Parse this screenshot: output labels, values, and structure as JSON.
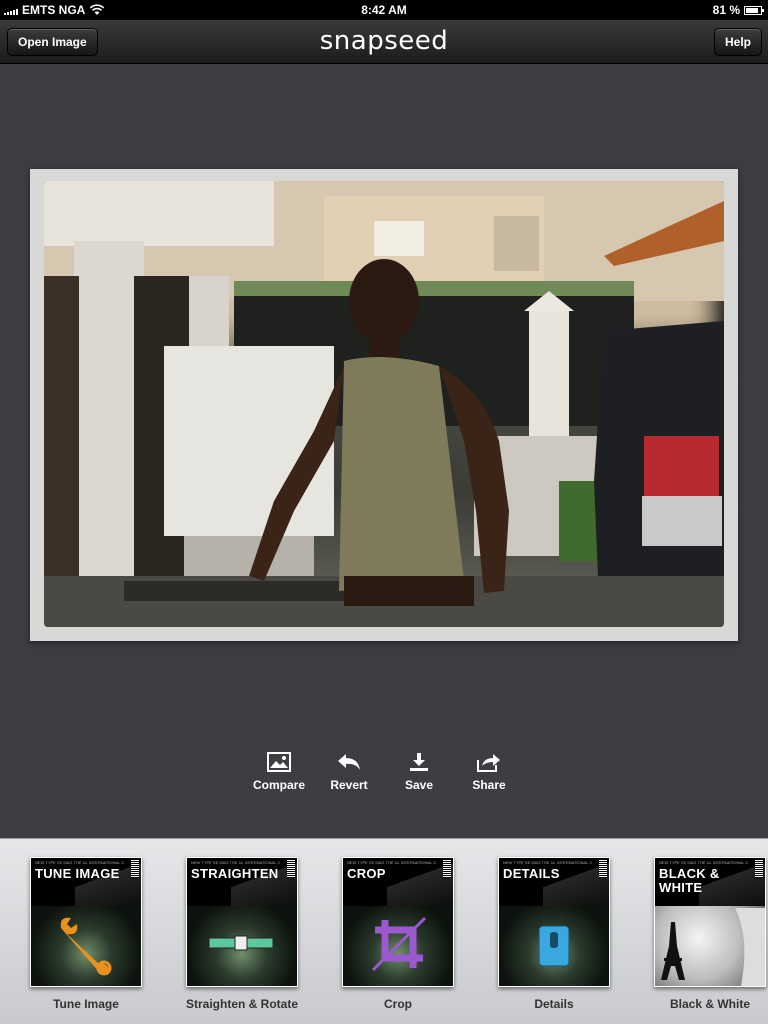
{
  "status": {
    "carrier": "EMTS NGA",
    "time": "8:42 AM",
    "battery": "81 %"
  },
  "navbar": {
    "open_label": "Open Image",
    "logo": "snapseed",
    "help_label": "Help"
  },
  "toolbar": {
    "compare_label": "Compare",
    "revert_label": "Revert",
    "save_label": "Save",
    "share_label": "Share"
  },
  "filters": [
    {
      "card_title": "TUNE IMAGE",
      "label": "Tune Image",
      "icon": "wrench-icon"
    },
    {
      "card_title": "STRAIGHTEN",
      "label": "Straighten & Rotate",
      "icon": "level-icon"
    },
    {
      "card_title": "CROP",
      "label": "Crop",
      "icon": "crop-icon"
    },
    {
      "card_title": "DETAILS",
      "label": "Details",
      "icon": "sharpener-icon"
    },
    {
      "card_title": "BLACK & WHITE",
      "label": "Black & White",
      "icon": "eiffel-tower-photo"
    }
  ],
  "card_fineprint": "NEW TYPE SE MAG THE UL INTERNATIONAL 3",
  "colors": {
    "accent_orange": "#e8911f",
    "level_green": "#5dc8a0",
    "crop_purple": "#9b59d0",
    "details_blue": "#3aa8de"
  }
}
